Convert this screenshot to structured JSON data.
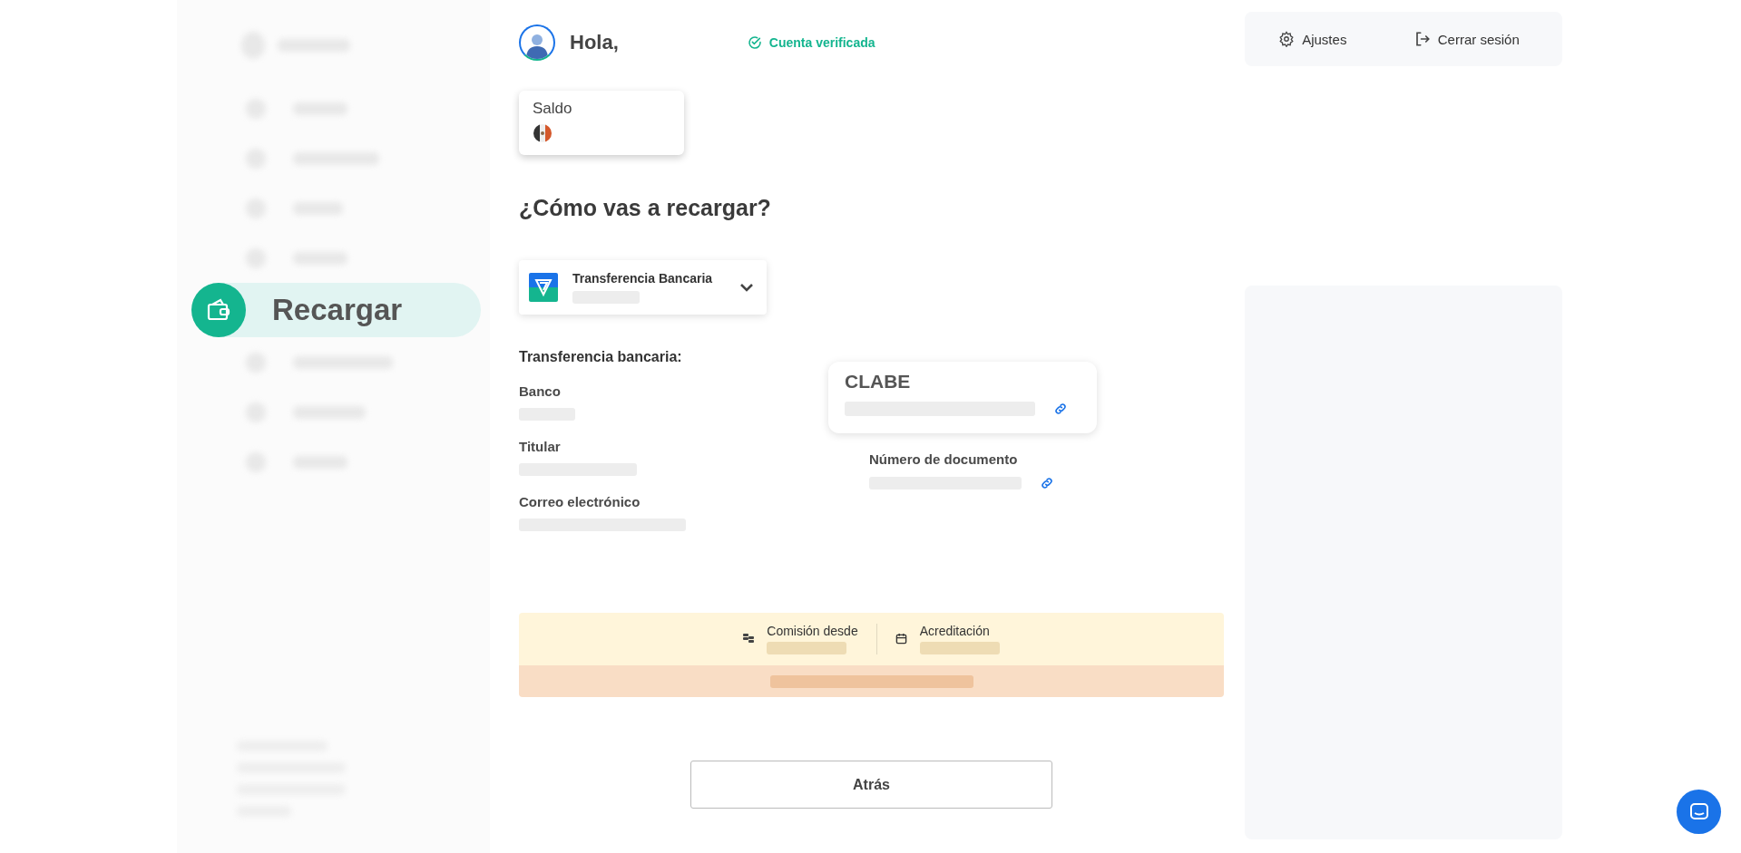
{
  "sidebar": {
    "items": [
      {
        "kind": "blurred",
        "selected": false
      },
      {
        "kind": "blurred",
        "selected": false
      },
      {
        "kind": "blurred",
        "selected": false
      },
      {
        "kind": "blurred",
        "selected": false
      },
      {
        "kind": "link",
        "label": "Recargar",
        "selected": true
      },
      {
        "kind": "blurred",
        "selected": false
      },
      {
        "kind": "blurred",
        "selected": false
      },
      {
        "kind": "blurred",
        "selected": false
      }
    ]
  },
  "header": {
    "greeting": "Hola,",
    "verified": "Cuenta verificada"
  },
  "balance": {
    "label": "Saldo"
  },
  "heading": "¿Cómo vas a recargar?",
  "method": {
    "label": "Transferencia Bancaria"
  },
  "details": {
    "title": "Transferencia bancaria:",
    "fields": [
      {
        "label": "Banco",
        "copyable": false
      },
      {
        "label": "Titular",
        "copyable": false
      },
      {
        "label": "Correo electrónico",
        "copyable": false
      }
    ],
    "highlight": {
      "label": "CLABE",
      "copyable": true
    },
    "right_field": {
      "label": "Número de documento",
      "copyable": true
    }
  },
  "info": [
    {
      "kind": "fee",
      "label": "Comisión desde"
    },
    {
      "kind": "time",
      "label": "Acreditación"
    }
  ],
  "back_button": "Atrás",
  "top_actions": [
    {
      "kind": "settings",
      "label": "Ajustes"
    },
    {
      "kind": "logout",
      "label": "Cerrar sesión"
    }
  ]
}
